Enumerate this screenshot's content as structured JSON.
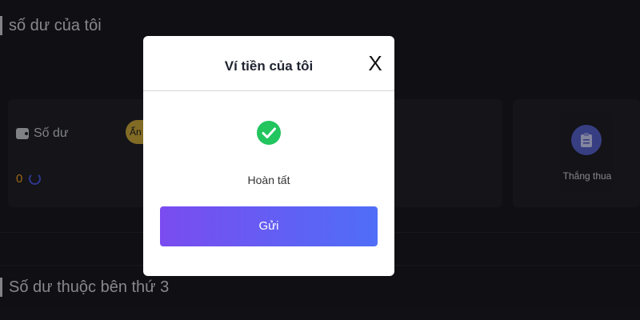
{
  "page": {
    "section_title": "số dư của tôi",
    "balance_label": "Số dư",
    "hide_pill": "Ẩn",
    "balance_value": "0",
    "win_loss_label": "Thắng thua",
    "third_party_title": "Số dư thuộc bên thứ 3"
  },
  "modal": {
    "title": "Ví tiền của tôi",
    "close_label": "X",
    "status_text": "Hoàn tất",
    "send_button": "Gửi"
  },
  "icons": {
    "wallet": "wallet-icon",
    "refresh": "refresh-icon",
    "clipboard": "clipboard-icon",
    "success": "check-circle-icon",
    "close": "close-icon"
  },
  "colors": {
    "background": "#1a1a20",
    "accent_gold": "#c7a53a",
    "balance_orange": "#f0a020",
    "success_green": "#22c55e",
    "button_gradient_start": "#7a4cf0",
    "button_gradient_end": "#4f6ef7"
  }
}
